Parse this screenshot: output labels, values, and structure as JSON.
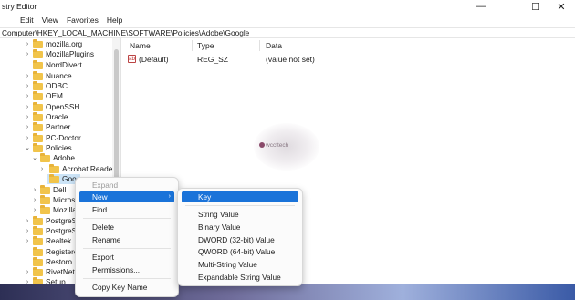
{
  "window": {
    "title": "stry Editor",
    "controls": {
      "minimize": "—",
      "maximize": "☐",
      "close": "✕"
    }
  },
  "menubar": [
    "Edit",
    "View",
    "Favorites",
    "Help"
  ],
  "address": "Computer\\HKEY_LOCAL_MACHINE\\SOFTWARE\\Policies\\Adobe\\Google",
  "tree": [
    {
      "label": "mozilla.org",
      "chevron": "›"
    },
    {
      "label": "MozillaPlugins",
      "chevron": "›"
    },
    {
      "label": "NordDivert",
      "chevron": ""
    },
    {
      "label": "Nuance",
      "chevron": "›"
    },
    {
      "label": "ODBC",
      "chevron": "›"
    },
    {
      "label": "OEM",
      "chevron": "›"
    },
    {
      "label": "OpenSSH",
      "chevron": "›"
    },
    {
      "label": "Oracle",
      "chevron": "›"
    },
    {
      "label": "Partner",
      "chevron": "›"
    },
    {
      "label": "PC-Doctor",
      "chevron": "›"
    },
    {
      "label": "Policies",
      "chevron": "⌄"
    },
    {
      "label": "Adobe",
      "chevron": "⌄"
    },
    {
      "label": "Acrobat Reader",
      "chevron": "›"
    },
    {
      "label": "Goo",
      "chevron": ""
    },
    {
      "label": "Dell",
      "chevron": "›"
    },
    {
      "label": "Micros",
      "chevron": "›"
    },
    {
      "label": "Mozilla",
      "chevron": "›"
    },
    {
      "label": "PostgreSC",
      "chevron": "›"
    },
    {
      "label": "PostgreSC",
      "chevron": "›"
    },
    {
      "label": "Realtek",
      "chevron": "›"
    },
    {
      "label": "Registere",
      "chevron": ""
    },
    {
      "label": "Restoro",
      "chevron": ""
    },
    {
      "label": "RivetNetw",
      "chevron": "›"
    },
    {
      "label": "Setup",
      "chevron": "›"
    }
  ],
  "list": {
    "columns": [
      "Name",
      "Type",
      "Data"
    ],
    "rows": [
      {
        "icon": "ab",
        "name": "(Default)",
        "type": "REG_SZ",
        "data": "(value not set)"
      }
    ]
  },
  "watermark": "wccftech",
  "context_menu": {
    "items": [
      "Expand",
      "New",
      "Find...",
      "Delete",
      "Rename",
      "Export",
      "Permissions...",
      "Copy Key Name"
    ],
    "new_arrow": "›"
  },
  "submenu": {
    "items": [
      "Key",
      "String Value",
      "Binary Value",
      "DWORD (32-bit) Value",
      "QWORD (64-bit) Value",
      "Multi-String Value",
      "Expandable String Value"
    ]
  },
  "colors": {
    "accent": "#1a73d9",
    "folder": "#f1c44b"
  }
}
